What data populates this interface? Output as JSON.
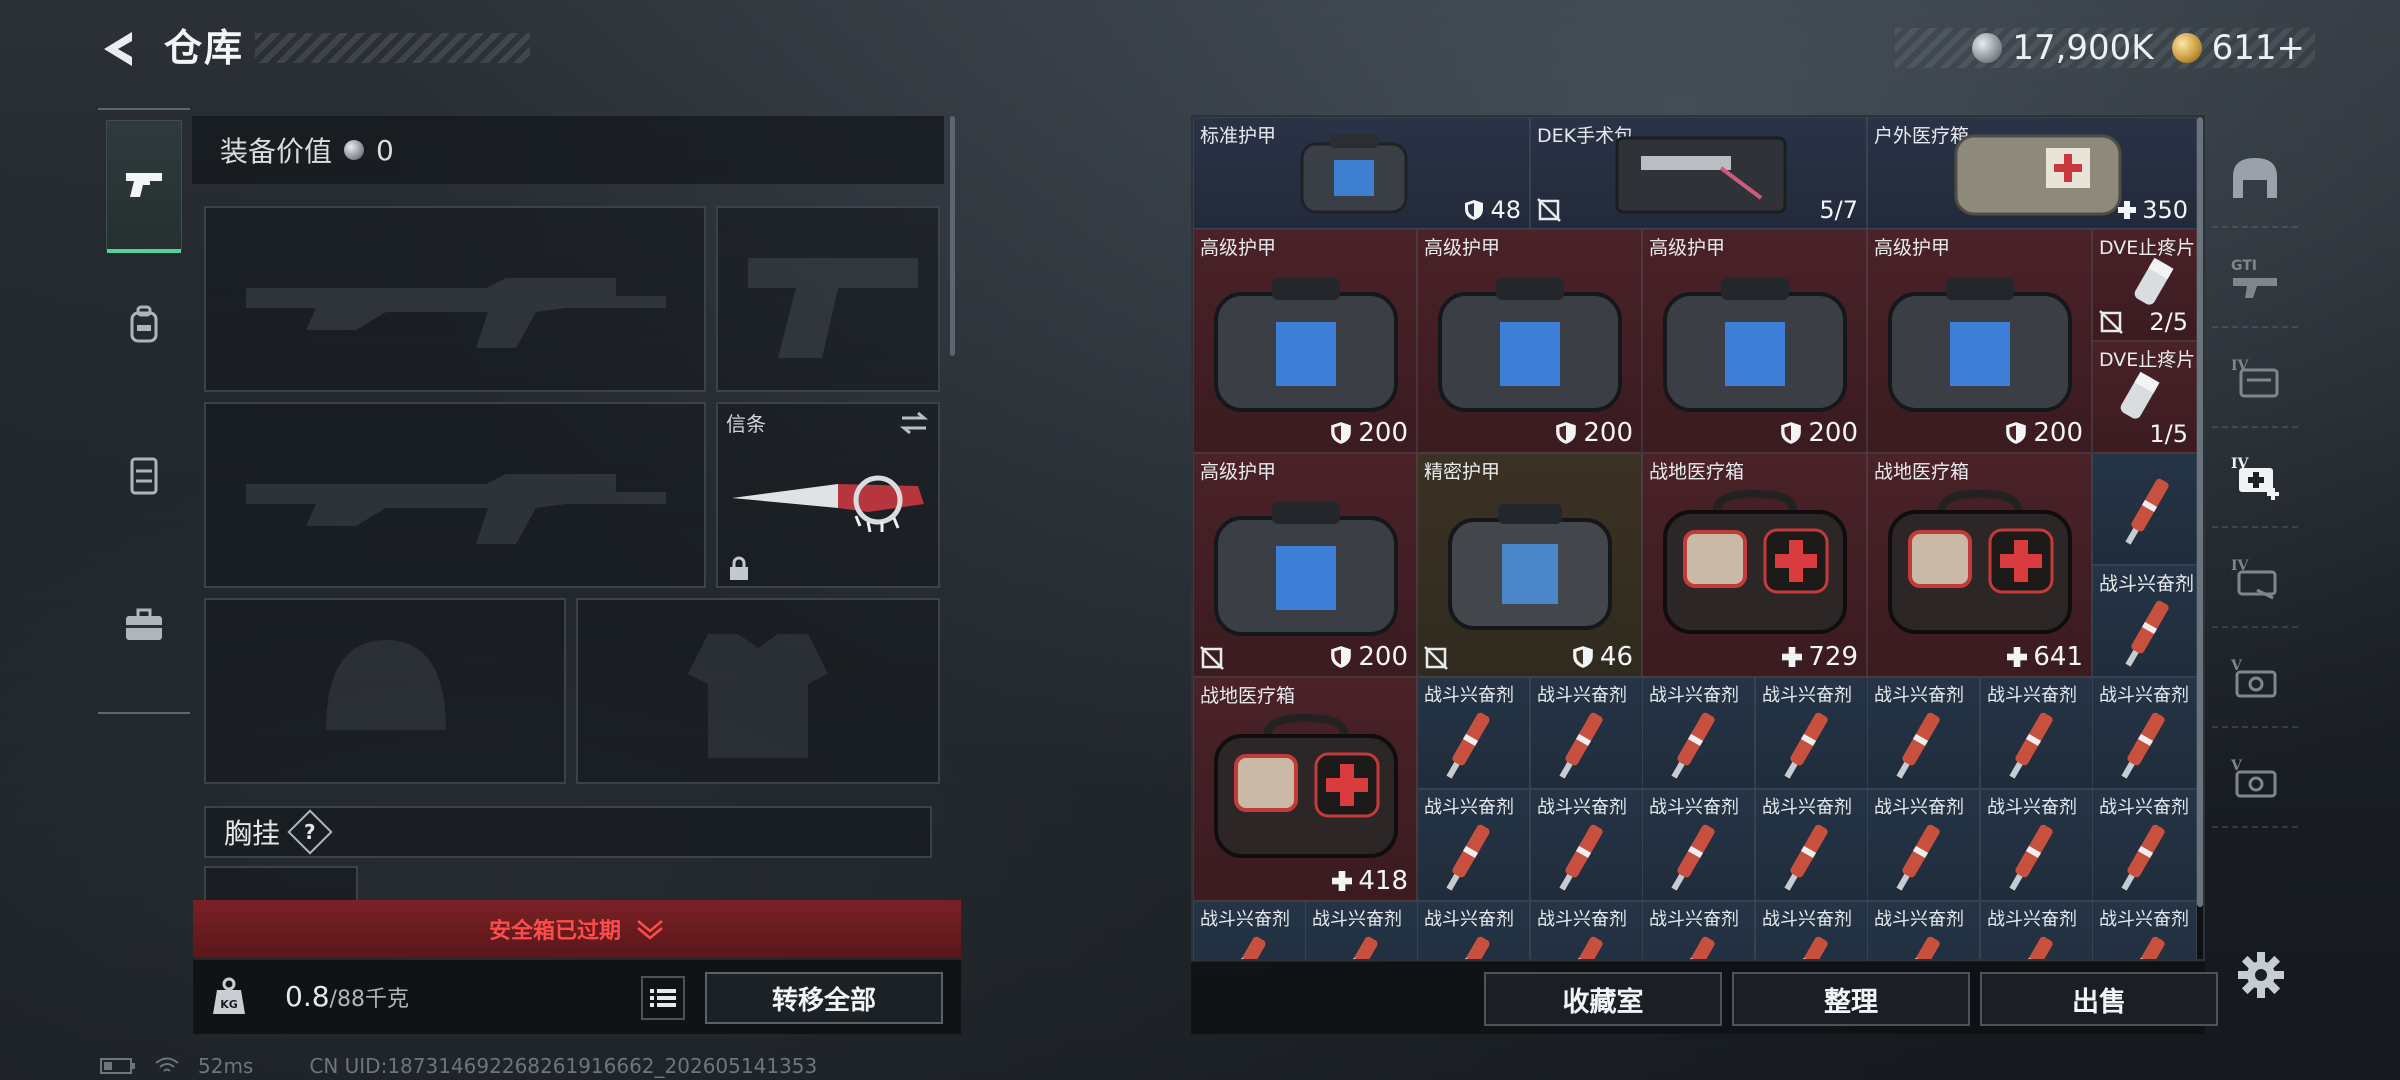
{
  "header": {
    "title": "仓库",
    "currency_silver": "17,900K",
    "currency_gold": "611+"
  },
  "equipment": {
    "value_label": "装备价值",
    "value": "0",
    "melee_label": "信条",
    "chest_label": "胸挂",
    "help": "?"
  },
  "safebox": {
    "text": "安全箱已过期"
  },
  "weight": {
    "current": "0.8",
    "max": "/88千克"
  },
  "buttons": {
    "transfer_all": "转移全部",
    "collection": "收藏室",
    "organize": "整理",
    "sell": "出售"
  },
  "status": {
    "ping": "52ms",
    "uid": "CN UID:18731469226826191666​2_202605141353"
  },
  "items": [
    {
      "name": "标准护甲",
      "stat": "48",
      "stat_icon": "shield-icon"
    },
    {
      "name": "DEK手术包",
      "stat": "5/7",
      "stat_icon": "none"
    },
    {
      "name": "户外医疗箱",
      "stat": "350",
      "stat_icon": "plus-icon"
    },
    {
      "name": "高级护甲",
      "stat": "200",
      "stat_icon": "shield-icon"
    },
    {
      "name": "高级护甲",
      "stat": "200",
      "stat_icon": "shield-icon"
    },
    {
      "name": "高级护甲",
      "stat": "200",
      "stat_icon": "shield-icon"
    },
    {
      "name": "高级护甲",
      "stat": "200",
      "stat_icon": "shield-icon"
    },
    {
      "name": "DVE止疼片",
      "stat": "2/5",
      "stat_icon": "none"
    },
    {
      "name": "DVE止疼片",
      "stat": "1/5",
      "stat_icon": "none"
    },
    {
      "name": "高级护甲",
      "stat": "200",
      "stat_icon": "shield-icon"
    },
    {
      "name": "精密护甲",
      "stat": "46",
      "stat_icon": "shield-icon"
    },
    {
      "name": "战地医疗箱",
      "stat": "729",
      "stat_icon": "plus-icon"
    },
    {
      "name": "战地医疗箱",
      "stat": "641",
      "stat_icon": "plus-icon"
    },
    {
      "name": "战斗兴奋剂"
    },
    {
      "name": "战斗兴奋剂"
    },
    {
      "name": "战地医疗箱",
      "stat": "418",
      "stat_icon": "plus-icon"
    },
    {
      "name": "战斗兴奋剂"
    }
  ]
}
